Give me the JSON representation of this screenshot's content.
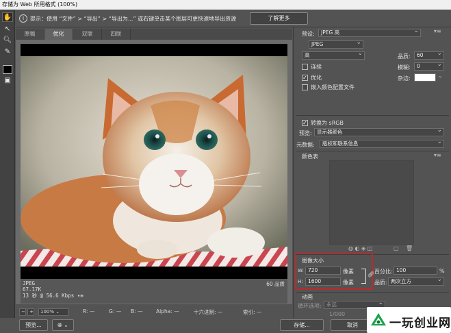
{
  "window": {
    "title": "存储为 Web 所用格式 (100%)"
  },
  "hint": {
    "text": "提示：使用 “文件” > “导出” > “导出为...” 或右键单击某个图层可更快速地导出资源",
    "learn_more": "了解更多"
  },
  "tabs": [
    {
      "label": "原稿",
      "active": false
    },
    {
      "label": "优化",
      "active": true
    },
    {
      "label": "双联",
      "active": false
    },
    {
      "label": "四联",
      "active": false
    }
  ],
  "preview": {
    "format": "JPEG",
    "size": "67.17K",
    "time": "13 秒 @ 56.6 Kbps",
    "quality": "60 品质"
  },
  "status": {
    "zoom": "100%",
    "r_label": "R:",
    "r_value": "—",
    "g_label": "G:",
    "g_value": "—",
    "b_label": "B:",
    "b_value": "—",
    "alpha_label": "Alpha:",
    "alpha_value": "—",
    "hex_label": "十六进制:",
    "hex_value": "—",
    "index_label": "索引:",
    "index_value": "—"
  },
  "footer": {
    "preview_btn": "预览...",
    "save_btn": "存储...",
    "cancel_btn": "取消"
  },
  "settings": {
    "preset_label": "预设:",
    "preset_value": "JPEG 高",
    "format_value": "JPEG",
    "compression_value": "高",
    "quality_label": "品质:",
    "quality_value": "60",
    "progressive_label": "连续",
    "progressive_checked": false,
    "blur_label": "模糊:",
    "blur_value": "0",
    "optimize_label": "优化",
    "optimize_checked": true,
    "matte_label": "杂边:",
    "embed_profile_label": "嵌入颜色配置文件",
    "embed_profile_checked": false,
    "srgb_label": "转换为 sRGB",
    "srgb_checked": true,
    "preview_label": "预览:",
    "preview_value": "显示器颜色",
    "metadata_label": "元数据:",
    "metadata_value": "版权和联系信息",
    "color_table_label": "颜色表"
  },
  "image_size": {
    "title": "图像大小",
    "w_label": "W:",
    "w_value": "720",
    "h_label": "H:",
    "h_value": "1600",
    "unit": "像素",
    "percent_label": "百分比:",
    "percent_value": "100",
    "percent_unit": "%",
    "quality_label": "品质:",
    "quality_value": "两次立方"
  },
  "animation": {
    "title": "动画",
    "loop_label": "循环选项:",
    "loop_value": "永远",
    "frame_counter": "1/000"
  },
  "watermark": {
    "text": "一玩创业网"
  },
  "colors": {
    "dialog_bg": "#535353",
    "highlight_red": "#c0282a",
    "watermark_brand": "#18a34a"
  }
}
